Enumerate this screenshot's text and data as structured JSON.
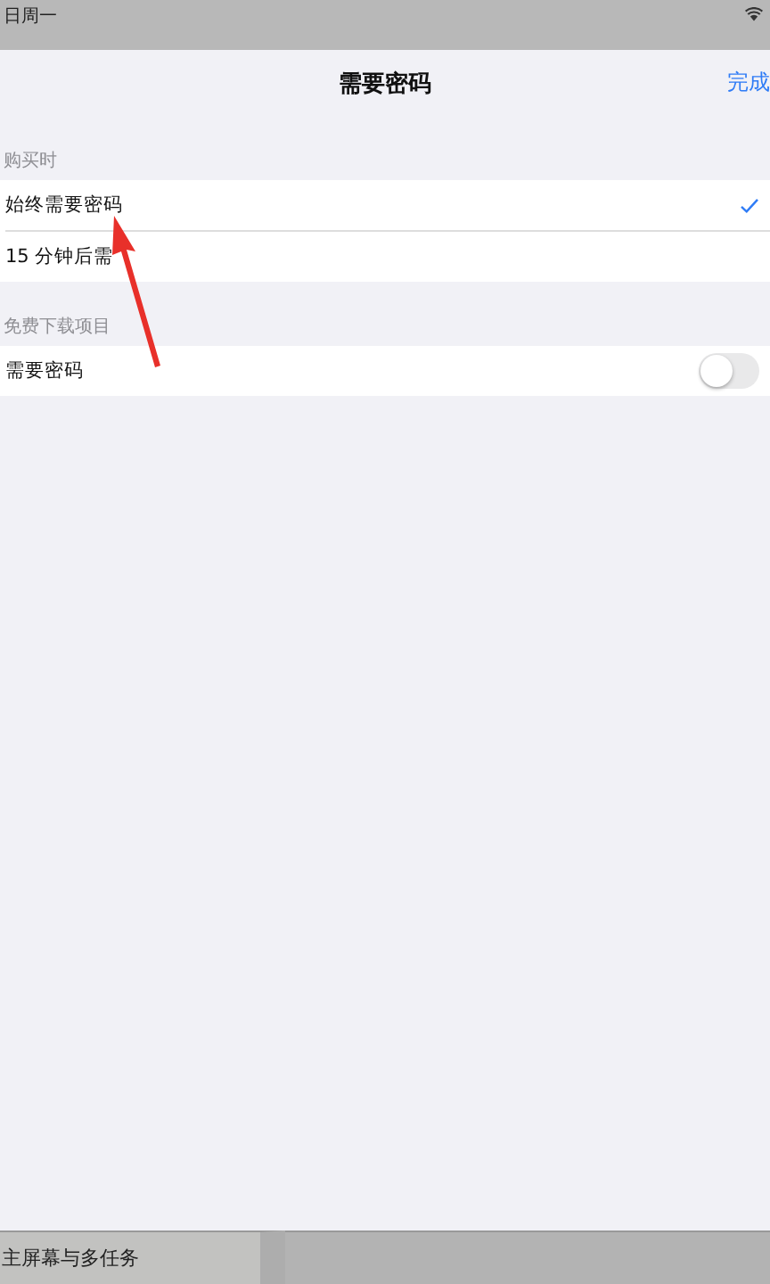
{
  "status_bar": {
    "date": "日周一"
  },
  "sheet": {
    "title": "需要密码",
    "done_button": "完成"
  },
  "sections": [
    {
      "header": "购买时",
      "kind": "options",
      "rows": [
        {
          "label": "始终需要密码",
          "selected": true
        },
        {
          "label": "15 分钟后需",
          "selected": false
        }
      ]
    },
    {
      "header": "免费下载项目",
      "kind": "toggles",
      "rows": [
        {
          "label": "需要密码",
          "on": false
        }
      ]
    }
  ],
  "background_sidebar": {
    "item": "主屏幕与多任务"
  }
}
